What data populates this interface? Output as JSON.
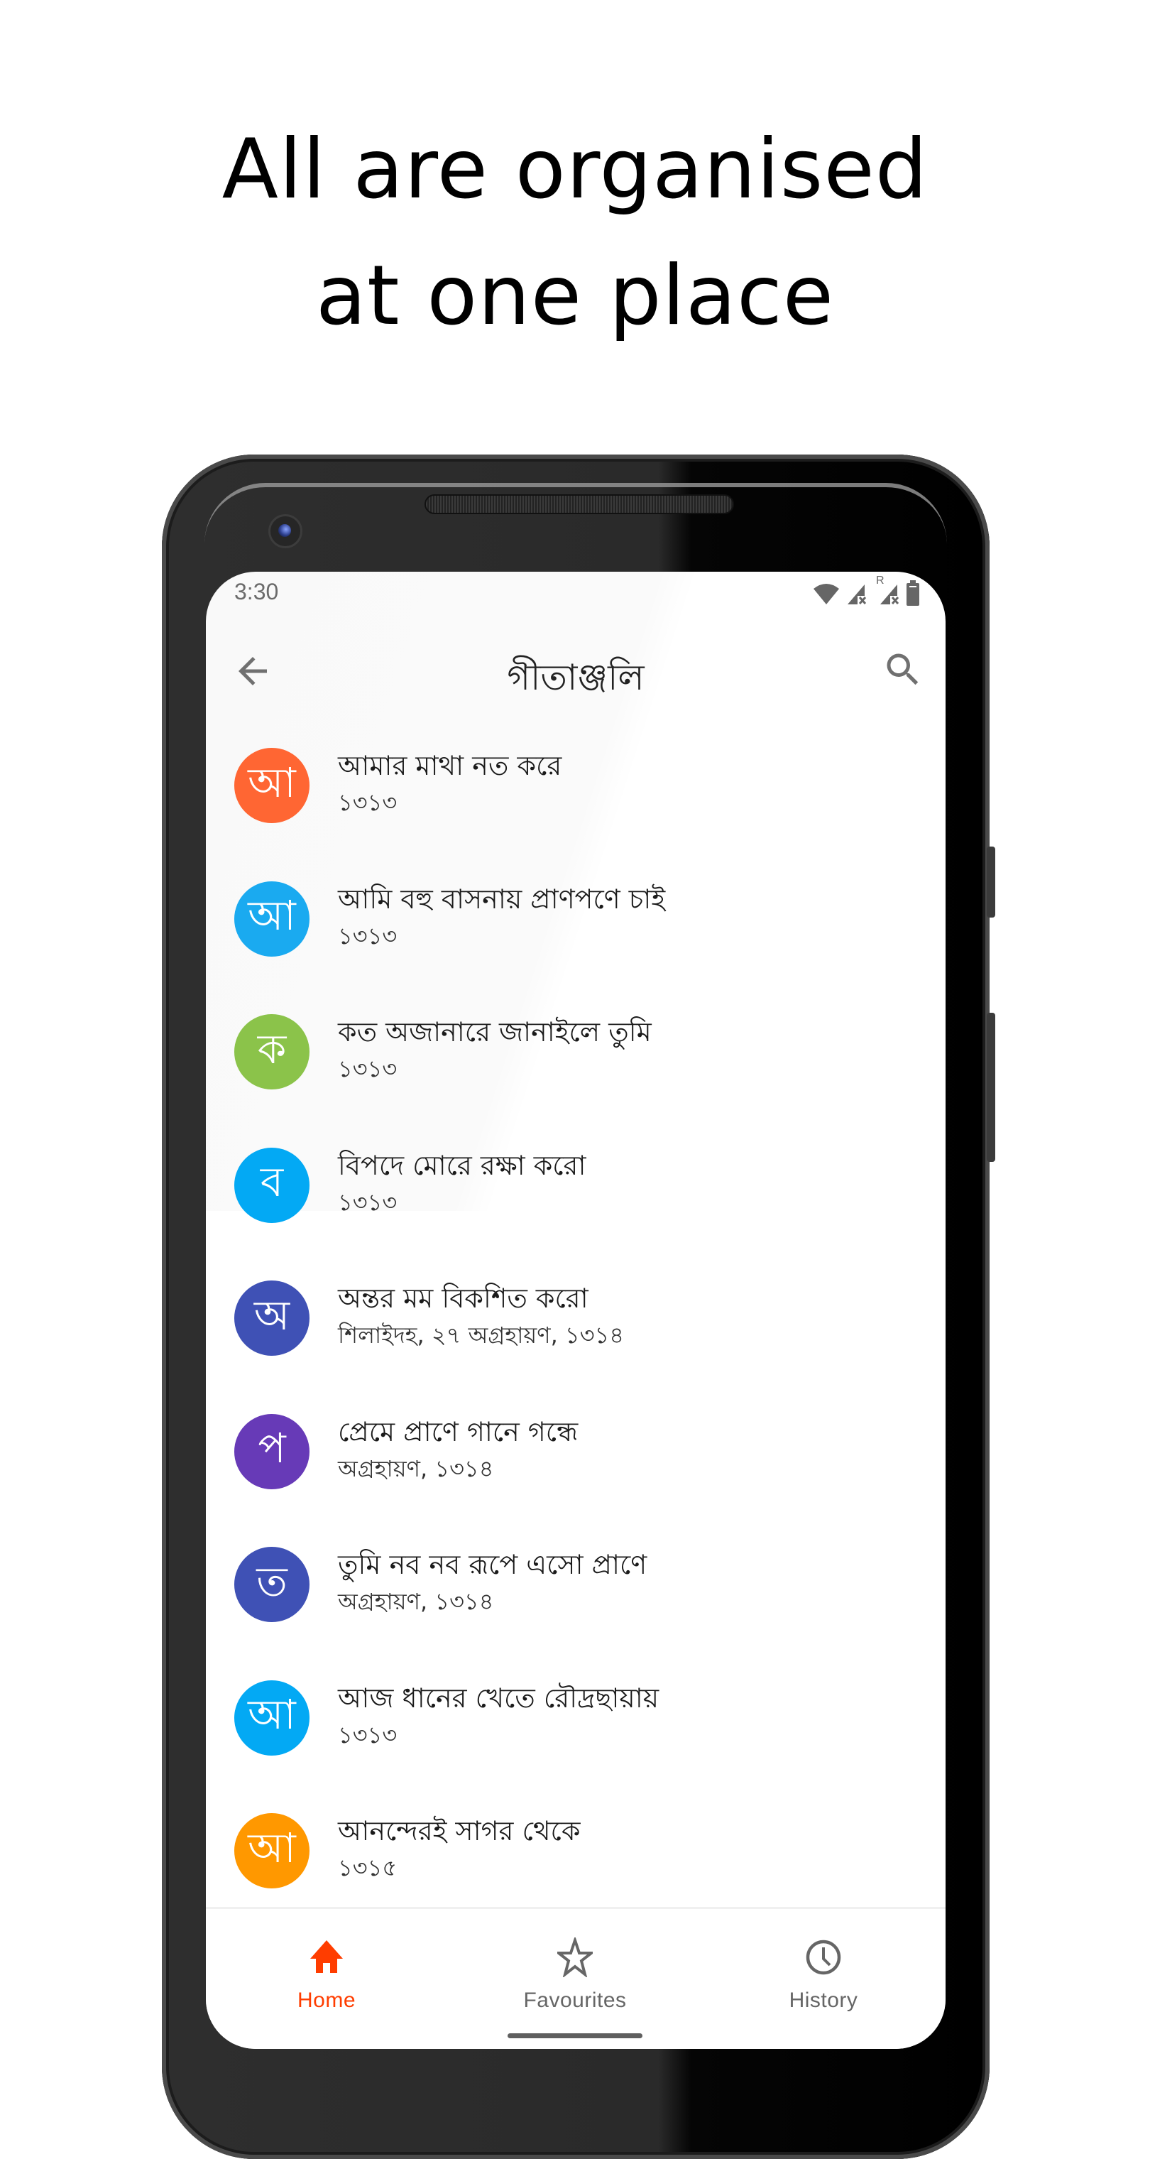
{
  "headline": {
    "line1": "All are organised",
    "line2": "at one place"
  },
  "status_bar": {
    "time": "3:30",
    "roaming_label": "R",
    "icons": [
      "wifi-icon",
      "signal-no-data-icon",
      "signal-roaming-no-data-icon",
      "battery-icon"
    ]
  },
  "app_bar": {
    "title": "গীতাঞ্জলি",
    "back_icon": "arrow-back-icon",
    "search_icon": "search-icon"
  },
  "songs": [
    {
      "letter": "আ",
      "title": "আমার মাথা নত করে",
      "subtitle": "১৩১৩",
      "color": "#FF6633"
    },
    {
      "letter": "আ",
      "title": "আমি বহু বাসনায় প্রাণপণে চাই",
      "subtitle": "১৩১৩",
      "color": "#1AAAF0"
    },
    {
      "letter": "ক",
      "title": "কত অজানারে জানাইলে তুমি",
      "subtitle": "১৩১৩",
      "color": "#8BC34A"
    },
    {
      "letter": "ব",
      "title": "বিপদে মোরে রক্ষা করো",
      "subtitle": "১৩১৩",
      "color": "#03A9F4"
    },
    {
      "letter": "অ",
      "title": "অন্তর মম বিকশিত করো",
      "subtitle": "শিলাইদহ, ২৭ অগ্রহায়ণ, ১৩১৪",
      "color": "#3F51B5"
    },
    {
      "letter": "প",
      "title": "প্রেমে প্রাণে গানে গন্ধে",
      "subtitle": "অগ্রহায়ণ, ১৩১৪",
      "color": "#673AB7"
    },
    {
      "letter": "ত",
      "title": "তুমি নব নব রূপে এসো প্রাণে",
      "subtitle": "অগ্রহায়ণ, ১৩১৪",
      "color": "#3F51B5"
    },
    {
      "letter": "আ",
      "title": "আজ ধানের খেতে রৌদ্রছায়ায়",
      "subtitle": "১৩১৩",
      "color": "#03A9F4"
    },
    {
      "letter": "আ",
      "title": "আনন্দেরই সাগর থেকে",
      "subtitle": "১৩১৫",
      "color": "#FF9800"
    }
  ],
  "bottom_nav": {
    "items": [
      {
        "label": "Home",
        "icon": "home-icon",
        "active": true
      },
      {
        "label": "Favourites",
        "icon": "star-icon",
        "active": false
      },
      {
        "label": "History",
        "icon": "clock-icon",
        "active": false
      }
    ],
    "active_color": "#FF3D00",
    "inactive_color": "#666666"
  }
}
